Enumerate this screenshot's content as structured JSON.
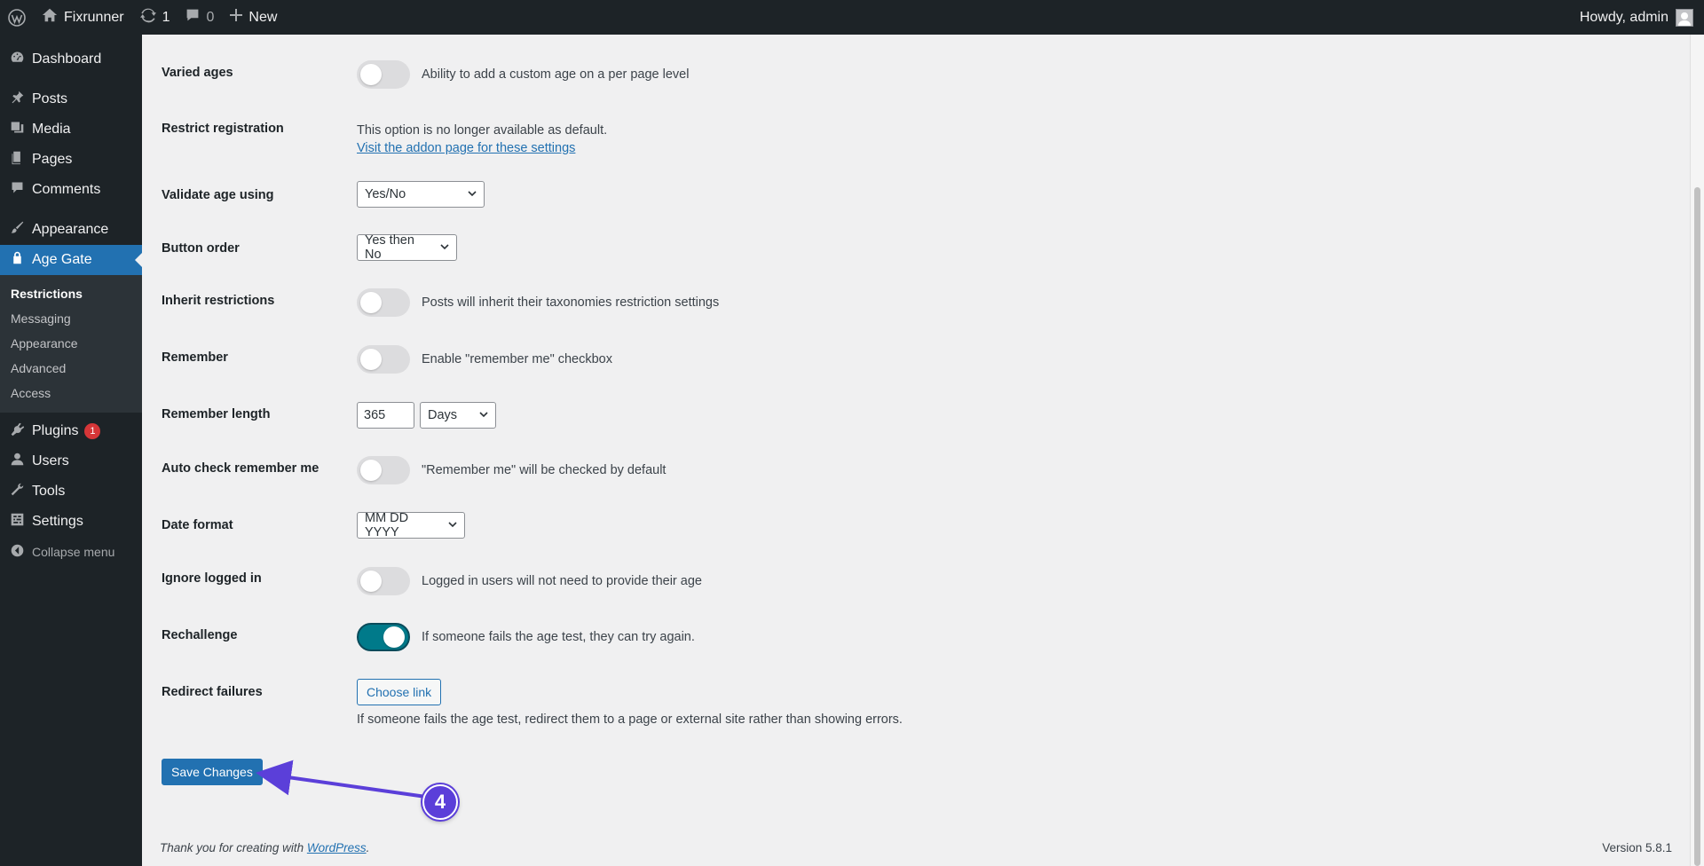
{
  "admin_bar": {
    "site_name": "Fixrunner",
    "updates_count": "1",
    "comments_count": "0",
    "new_label": "New",
    "greeting": "Howdy, admin"
  },
  "sidebar": {
    "items_top": [
      {
        "label": "Dashboard",
        "icon": "dashboard-icon"
      }
    ],
    "items_mid": [
      {
        "label": "Posts",
        "icon": "pin-icon"
      },
      {
        "label": "Media",
        "icon": "media-icon"
      },
      {
        "label": "Pages",
        "icon": "pages-icon"
      },
      {
        "label": "Comments",
        "icon": "comment-icon"
      }
    ],
    "appearance_label": "Appearance",
    "current_label": "Age Gate",
    "submenu": [
      "Restrictions",
      "Messaging",
      "Appearance",
      "Advanced",
      "Access"
    ],
    "plugins_label": "Plugins",
    "plugins_badge": "1",
    "users_label": "Users",
    "tools_label": "Tools",
    "settings_label": "Settings",
    "collapse_label": "Collapse menu"
  },
  "settings": {
    "varied_ages": {
      "label": "Varied ages",
      "desc": "Ability to add a custom age on a per page level",
      "enabled": false
    },
    "restrict_registration": {
      "label": "Restrict registration",
      "desc": "This option is no longer available as default.",
      "link": "Visit the addon page for these settings"
    },
    "validate_age": {
      "label": "Validate age using",
      "value": "Yes/No"
    },
    "button_order": {
      "label": "Button order",
      "value": "Yes then No"
    },
    "inherit": {
      "label": "Inherit restrictions",
      "desc": "Posts will inherit their taxonomies restriction settings",
      "enabled": false
    },
    "remember": {
      "label": "Remember",
      "desc": "Enable \"remember me\" checkbox",
      "enabled": false
    },
    "remember_length": {
      "label": "Remember length",
      "value": "365",
      "unit": "Days"
    },
    "auto_check": {
      "label": "Auto check remember me",
      "desc": "\"Remember me\" will be checked by default",
      "enabled": false
    },
    "date_format": {
      "label": "Date format",
      "value": "MM DD YYYY"
    },
    "ignore_logged": {
      "label": "Ignore logged in",
      "desc": "Logged in users will not need to provide their age",
      "enabled": false
    },
    "rechallenge": {
      "label": "Rechallenge",
      "desc": "If someone fails the age test, they can try again.",
      "enabled": true
    },
    "redirect": {
      "label": "Redirect failures",
      "button": "Choose link",
      "desc": "If someone fails the age test, redirect them to a page or external site rather than showing errors."
    }
  },
  "save_button": "Save Changes",
  "footer": {
    "thanks_prefix": "Thank you for creating with ",
    "wordpress_link": "WordPress",
    "thanks_suffix": ".",
    "version": "Version 5.8.1"
  },
  "annotation": {
    "step": "4",
    "color": "#5b3fd9"
  }
}
